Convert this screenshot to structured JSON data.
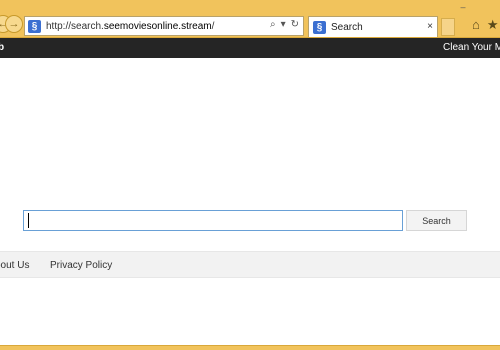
{
  "browser": {
    "url_prefix": "http://search.",
    "url_domain": "seemoviesonline.stream",
    "url_suffix": "/",
    "tab_title": "Search",
    "site_icon_glyph": "§",
    "addr_tools": [
      "⌕",
      "▾",
      "↻"
    ],
    "tab_close": "×",
    "right_icons": [
      "⌂",
      "★"
    ],
    "window_min": "–",
    "frame_color": "#f1c35c"
  },
  "topbar": {
    "brand": "b",
    "link": "Clean Your Ma"
  },
  "search": {
    "value": "",
    "button_label": "Search"
  },
  "footer": {
    "links": [
      "bout Us",
      "Privacy Policy"
    ]
  }
}
